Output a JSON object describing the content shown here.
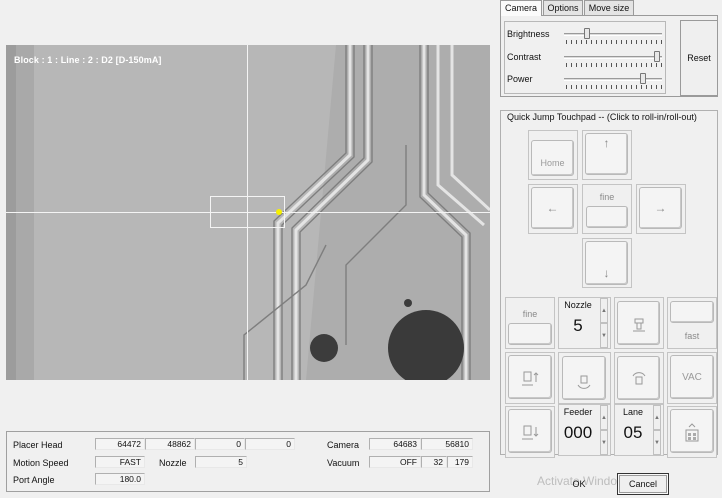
{
  "camera_view": {
    "overlay": "Block : 1 : Line : 2 : D2 [D-150mA]"
  },
  "tabs": [
    "Camera",
    "Options",
    "Move size"
  ],
  "camera_settings": {
    "sliders": [
      {
        "label": "Brightness",
        "level": 0.22
      },
      {
        "label": "Contrast",
        "level": 0.98
      },
      {
        "label": "Power",
        "level": 0.83
      }
    ],
    "reset_label": "Reset"
  },
  "touchpad": {
    "title": "Quick Jump Touchpad -- (Click to roll-in/roll-out)",
    "home_label": "Home",
    "up_icon": "↑",
    "down_icon": "↓",
    "left_icon": "←",
    "right_icon": "→",
    "fine_center_label": "fine",
    "fine_label": "fine",
    "fast_label": "fast",
    "vac_label": "VAC",
    "nozzle_label": "Nozzle",
    "nozzle_value": "5",
    "feeder_label": "Feeder",
    "feeder_value": "000",
    "lane_label": "Lane",
    "lane_value": "05"
  },
  "status": {
    "placer_head_label": "Placer Head",
    "placer_head_values": [
      "64472",
      "48862",
      "0",
      "0"
    ],
    "motion_speed_label": "Motion Speed",
    "motion_speed_value": "FAST",
    "nozzle_label": "Nozzle",
    "nozzle_value": "5",
    "port_angle_label": "Port Angle",
    "port_angle_value": "180.0",
    "camera_label": "Camera",
    "camera_values": [
      "64683",
      "56810"
    ],
    "vacuum_label": "Vacuum",
    "vacuum_values": [
      "OFF",
      "32",
      "179"
    ]
  },
  "footer": {
    "watermark": "Activate Windows",
    "ok_label": "OK",
    "cancel_label": "Cancel"
  }
}
